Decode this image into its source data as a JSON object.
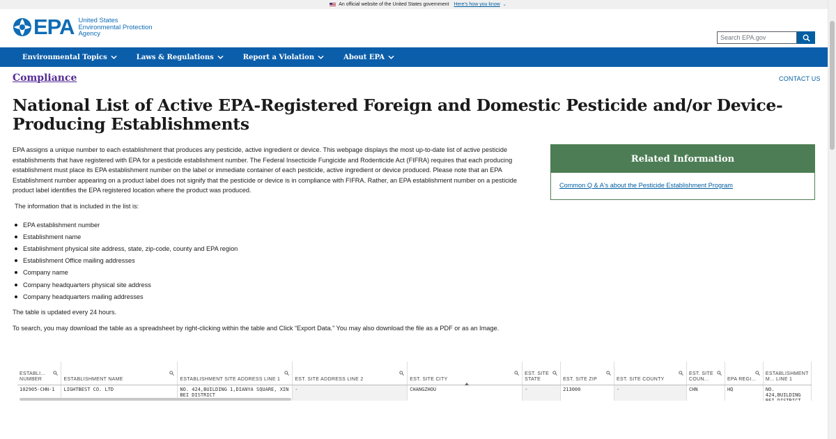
{
  "gov_banner": {
    "text": "An official website of the United States government",
    "link": "Here's how you know"
  },
  "header": {
    "logo_text": "EPA",
    "agency_lines": [
      "United States",
      "Environmental Protection",
      "Agency"
    ],
    "search_placeholder": "Search EPA.gov"
  },
  "nav": {
    "items": [
      "Environmental Topics",
      "Laws & Regulations",
      "Report a Violation",
      "About EPA"
    ]
  },
  "breadcrumb": {
    "section": "Compliance",
    "contact": "CONTACT US"
  },
  "page": {
    "title": "National List of Active EPA-Registered Foreign and Domestic Pesticide and/or Device-Producing Establishments",
    "intro": "EPA assigns a unique number to each establishment that produces any pesticide, active ingredient or device. This webpage displays the most up-to-date list of active pesticide establishments that have registered with EPA for a pesticide establishment number. The Federal Insecticide Fungicide and Rodenticide Act (FIFRA) requires that each producing establishment must place its EPA establishment number on the label or immediate container of each pesticide, active ingredient or device produced. Please note that an EPA Establishment number appearing on a product label does not signify that the pesticide or device is in compliance with FIFRA. Rather, an EPA establishment number on a pesticide product label identifies the EPA registered location where the product was produced.",
    "info_lead": "The information that is included in the list is:",
    "bullets": [
      "EPA establishment number",
      "Establishment name",
      "Establishment physical site address, state, zip-code, county and EPA region",
      "Establishment Office mailing addresses",
      "Company name",
      "Company headquarters physical site address",
      "Company headquarters mailing addresses"
    ],
    "updated": "The table is updated every 24 hours.",
    "search_note": "To search, you may download the table as a spreadsheet by right-clicking within the table and Click “Export Data.”  You may also download the file as a PDF or as an Image."
  },
  "related": {
    "heading": "Related Information",
    "link": "Common Q & A's about the Pesticide Establishment Program"
  },
  "table": {
    "columns": [
      "ESTABLI... NUMBER",
      "ESTABLISHMENT NAME",
      "ESTABLISHMENT SITE ADDRESS LINE 1",
      "EST. SITE ADDRESS LINE 2",
      "EST. SITE CITY",
      "EST. SITE STATE",
      "EST. SITE ZIP",
      "EST. SITE COUNTY",
      "EST. SITE COUN...",
      "EPA REGI...",
      "ESTABLISHMENT M... LINE 1"
    ],
    "rows": [
      [
        "102905-CHN-1",
        "LIGHTBEST CO. LTD",
        "NO. 424,BUILDING 1,DIANYA SQUARE, XIN BEI DISTRICT",
        "-",
        "CHANGZHOU",
        "-",
        "213000",
        "-",
        "CHN",
        "HQ",
        "NO. 424,BUILDING BEI DISTRICT"
      ]
    ]
  },
  "colors": {
    "nav_bg": "#0b5eaa",
    "logo_blue": "#0e6cb5",
    "related_green": "#4d7d55",
    "link_blue": "#005ea2",
    "visited_purple": "#562b97"
  }
}
